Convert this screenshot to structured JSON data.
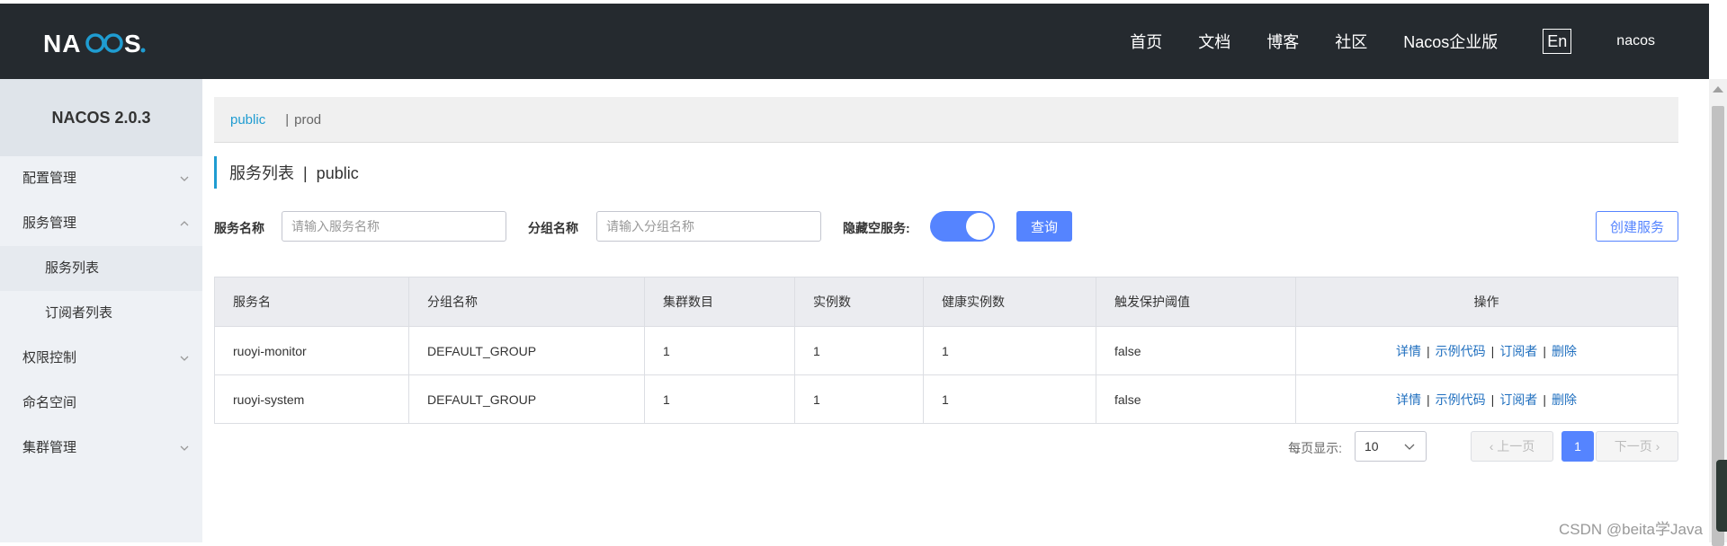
{
  "header": {
    "logo_text": "NACOS.",
    "nav": [
      "首页",
      "文档",
      "博客",
      "社区",
      "Nacos企业版"
    ],
    "lang": "En",
    "user": "nacos"
  },
  "sidebar": {
    "title": "NACOS 2.0.3",
    "items": [
      {
        "label": "配置管理"
      },
      {
        "label": "服务管理"
      },
      {
        "label": "服务列表"
      },
      {
        "label": "订阅者列表"
      },
      {
        "label": "权限控制"
      },
      {
        "label": "命名空间"
      },
      {
        "label": "集群管理"
      }
    ]
  },
  "namespace": {
    "active": "public",
    "separator": "|",
    "other": "prod"
  },
  "page": {
    "title": "服务列表  |  public"
  },
  "filters": {
    "service_label": "服务名称",
    "service_placeholder": "请输入服务名称",
    "group_label": "分组名称",
    "group_placeholder": "请输入分组名称",
    "hide_empty_label": "隐藏空服务:",
    "hide_empty_on": true,
    "query_label": "查询",
    "create_label": "创建服务"
  },
  "table": {
    "columns": [
      "服务名",
      "分组名称",
      "集群数目",
      "实例数",
      "健康实例数",
      "触发保护阈值",
      "操作"
    ],
    "rows": [
      {
        "name": "ruoyi-monitor",
        "group": "DEFAULT_GROUP",
        "clusters": "1",
        "instances": "1",
        "healthy": "1",
        "threshold": "false"
      },
      {
        "name": "ruoyi-system",
        "group": "DEFAULT_GROUP",
        "clusters": "1",
        "instances": "1",
        "healthy": "1",
        "threshold": "false"
      }
    ],
    "ops": [
      "详情",
      "示例代码",
      "订阅者",
      "删除"
    ]
  },
  "pagination": {
    "per_page_label": "每页显示:",
    "per_page": "10",
    "prev": "上一页",
    "current": "1",
    "next": "下一页"
  },
  "watermark": "CSDN @beita学Java",
  "colors": {
    "header_bg": "#252a2f",
    "primary": "#5584ff",
    "link": "#1f6fbf",
    "ns_active": "#1f9cd1"
  }
}
